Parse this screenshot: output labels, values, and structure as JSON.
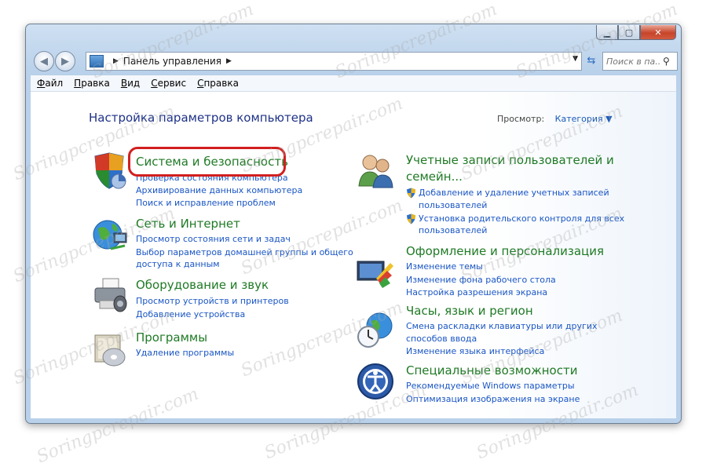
{
  "window": {
    "caption": {
      "min": "▁",
      "max": "▢",
      "close": "✕"
    }
  },
  "address": {
    "breadcrumb": "Панель управления",
    "search_placeholder": "Поиск в па..."
  },
  "menu": [
    "Файл",
    "Правка",
    "Вид",
    "Сервис",
    "Справка"
  ],
  "content": {
    "heading": "Настройка параметров компьютера",
    "viewby_label": "Просмотр:",
    "viewby_value": "Категория ▼"
  },
  "left": [
    {
      "title": "Система и безопасность",
      "icon": "shield-icon",
      "links": [
        "Проверка состояния компьютера",
        "Архивирование данных компьютера",
        "Поиск и исправление проблем"
      ]
    },
    {
      "title": "Сеть и Интернет",
      "icon": "globe-network-icon",
      "links": [
        "Просмотр состояния сети и задач",
        "Выбор параметров домашней группы и общего",
        "доступа к данным"
      ]
    },
    {
      "title": "Оборудование и звук",
      "icon": "printer-icon",
      "links": [
        "Просмотр устройств и принтеров",
        "Добавление устройства"
      ]
    },
    {
      "title": "Программы",
      "icon": "programs-icon",
      "links": [
        "Удаление программы"
      ]
    }
  ],
  "right": [
    {
      "title1": "Учетные записи пользователей и",
      "title2": "семейн...",
      "icon": "users-icon",
      "links": [
        "Добавление и удаление учетных записей",
        "пользователей",
        "Установка родительского контроля для всех",
        "пользователей"
      ]
    },
    {
      "title": "Оформление и персонализация",
      "icon": "personalization-icon",
      "links": [
        "Изменение темы",
        "Изменение фона рабочего стола",
        "Настройка разрешения экрана"
      ]
    },
    {
      "title": "Часы, язык и регион",
      "icon": "clock-globe-icon",
      "links": [
        "Смена раскладки клавиатуры или других",
        "способов ввода",
        "Изменение языка интерфейса"
      ]
    },
    {
      "title": "Специальные возможности",
      "icon": "accessibility-icon",
      "links": [
        "Рекомендуемые Windows параметры",
        "Оптимизация изображения на экране"
      ]
    }
  ],
  "watermark": "Soringpcrepair.com"
}
